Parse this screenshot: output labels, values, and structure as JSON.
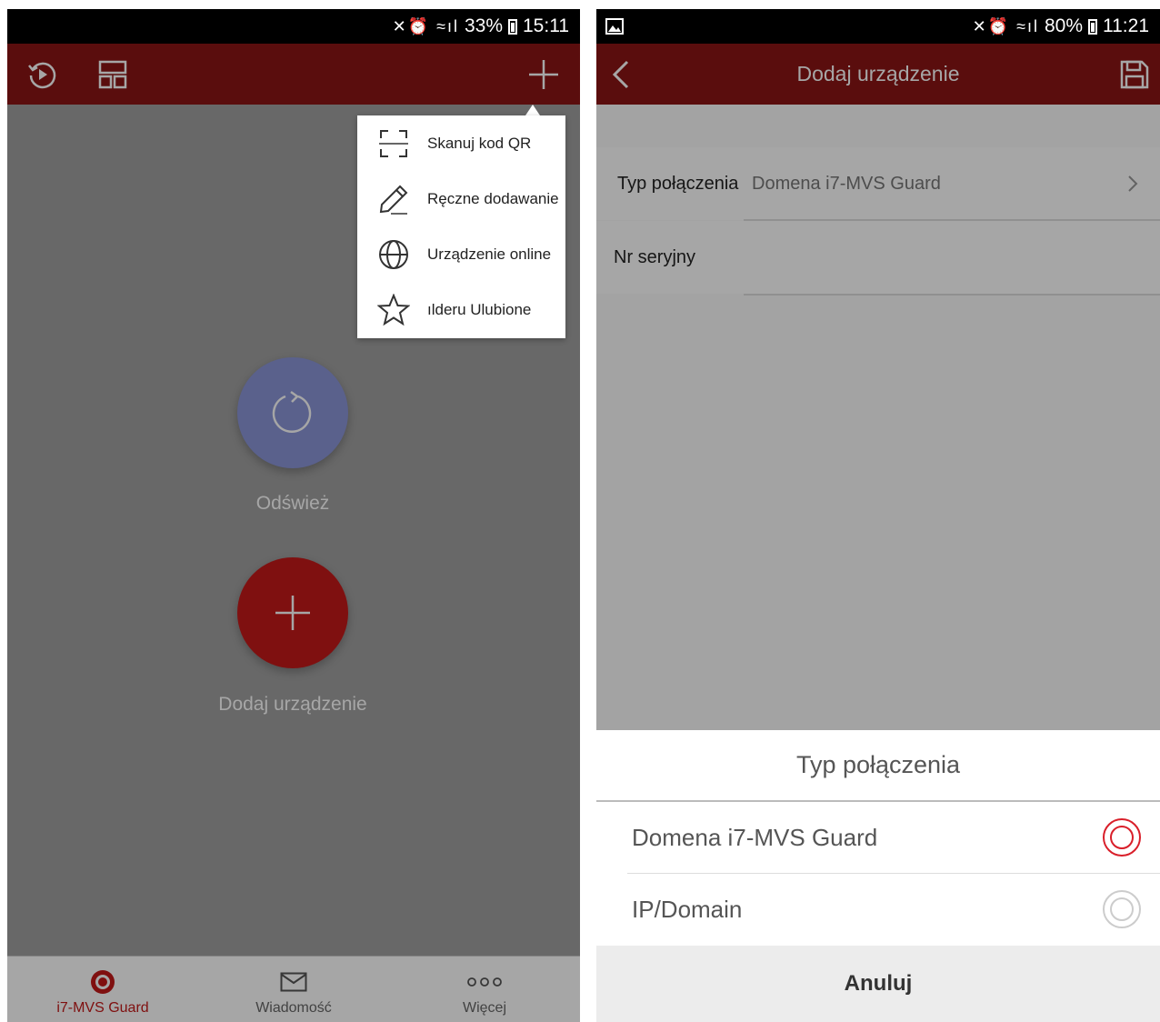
{
  "left_screen": {
    "status": {
      "battery": "33%",
      "time": "15:11"
    },
    "popup_menu": {
      "items": [
        {
          "label": "Skanuj kod QR",
          "icon": "qr-scan-icon"
        },
        {
          "label": "Ręczne dodawanie",
          "icon": "pencil-icon"
        },
        {
          "label": "Urządzenie online",
          "icon": "globe-icon"
        },
        {
          "label": "ılderu Ulubione",
          "icon": "star-icon"
        }
      ]
    },
    "refresh_label": "Odśwież",
    "add_device_label": "Dodaj urządzenie",
    "tabs": [
      {
        "label": "i7-MVS Guard",
        "icon": "camera-icon",
        "active": true
      },
      {
        "label": "Wiadomość",
        "icon": "envelope-icon",
        "active": false
      },
      {
        "label": "Więcej",
        "icon": "more-icon",
        "active": false
      }
    ],
    "colors": {
      "appbar": "#8b1414",
      "accent": "#c41a1a",
      "refresh": "#8a95d8"
    }
  },
  "right_screen": {
    "status": {
      "battery": "80%",
      "time": "11:21"
    },
    "title": "Dodaj urządzenie",
    "form": {
      "connection_type_label": "Typ połączenia",
      "connection_type_value": "Domena i7-MVS Guard",
      "serial_label": "Nr seryjny"
    },
    "sheet": {
      "title": "Typ połączenia",
      "options": [
        {
          "label": "Domena i7-MVS Guard",
          "selected": true
        },
        {
          "label": "IP/Domain",
          "selected": false
        }
      ],
      "cancel": "Anuluj"
    }
  }
}
